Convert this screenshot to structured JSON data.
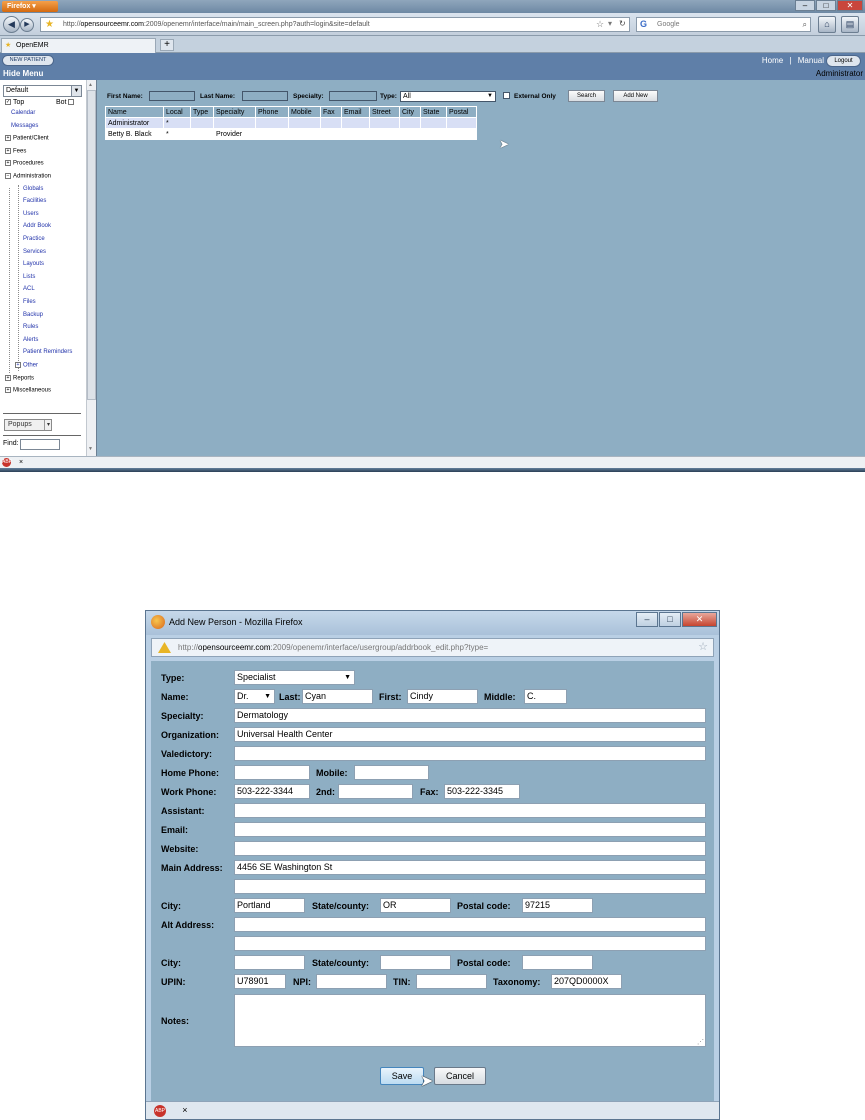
{
  "main_window": {
    "firefox_button": "Firefox",
    "url_prefix": "http://",
    "url_host": "opensourceemr.com",
    "url_rest": ":2009/openemr/interface/main/main_screen.php?auth=login&site=default",
    "search_placeholder": "Google",
    "tab_title": "OpenEMR",
    "new_patient": "NEW PATIENT",
    "hide_menu": "Hide Menu",
    "links": [
      "Home",
      "Manual"
    ],
    "logout": "Logout",
    "user": "Administrator"
  },
  "sidebar": {
    "view_select": "Default",
    "top_label": "Top",
    "bot_label": "Bot",
    "items": [
      {
        "label": "Calendar",
        "kind": "link"
      },
      {
        "label": "Messages",
        "kind": "link"
      },
      {
        "label": "Patient/Client",
        "kind": "group"
      },
      {
        "label": "Fees",
        "kind": "group"
      },
      {
        "label": "Procedures",
        "kind": "group"
      },
      {
        "label": "Administration",
        "kind": "group-open"
      },
      {
        "label": "Globals",
        "kind": "child"
      },
      {
        "label": "Facilities",
        "kind": "child"
      },
      {
        "label": "Users",
        "kind": "child"
      },
      {
        "label": "Addr Book",
        "kind": "child"
      },
      {
        "label": "Practice",
        "kind": "child"
      },
      {
        "label": "Services",
        "kind": "child"
      },
      {
        "label": "Layouts",
        "kind": "child"
      },
      {
        "label": "Lists",
        "kind": "child"
      },
      {
        "label": "ACL",
        "kind": "child"
      },
      {
        "label": "Files",
        "kind": "child"
      },
      {
        "label": "Backup",
        "kind": "child"
      },
      {
        "label": "Rules",
        "kind": "child"
      },
      {
        "label": "Alerts",
        "kind": "child"
      },
      {
        "label": "Patient Reminders",
        "kind": "child"
      },
      {
        "label": "Other",
        "kind": "child-group"
      },
      {
        "label": "Reports",
        "kind": "group"
      },
      {
        "label": "Miscellaneous",
        "kind": "group"
      }
    ],
    "popups": "Popups",
    "find_label": "Find:"
  },
  "addrbook": {
    "filters": {
      "first_name": "First Name:",
      "last_name": "Last Name:",
      "specialty": "Specialty:",
      "type": "Type:",
      "type_value": "All",
      "external_only": "External Only",
      "search": "Search",
      "add_new": "Add New"
    },
    "columns": [
      "Name",
      "Local",
      "Type",
      "Specialty",
      "Phone",
      "Mobile",
      "Fax",
      "Email",
      "Street",
      "City",
      "State",
      "Postal"
    ],
    "rows": [
      [
        "Administrator",
        "*",
        "",
        "",
        "",
        "",
        "",
        "",
        "",
        "",
        "",
        ""
      ],
      [
        "Betty B. Black",
        "*",
        "",
        "Provider",
        "",
        "",
        "",
        "",
        "",
        "",
        "",
        ""
      ]
    ]
  },
  "dialog": {
    "title": "Add New Person - Mozilla Firefox",
    "url_prefix": "http://",
    "url_host": "opensourceemr.com",
    "url_rest": ":2009/openemr/interface/usergroup/addrbook_edit.php?type=",
    "labels": {
      "type": "Type:",
      "name": "Name:",
      "last": "Last:",
      "first": "First:",
      "middle": "Middle:",
      "specialty": "Specialty:",
      "organization": "Organization:",
      "valedictory": "Valedictory:",
      "home_phone": "Home Phone:",
      "mobile": "Mobile:",
      "work_phone": "Work Phone:",
      "second": "2nd:",
      "fax": "Fax:",
      "assistant": "Assistant:",
      "email": "Email:",
      "website": "Website:",
      "main_address": "Main Address:",
      "city": "City:",
      "state": "State/county:",
      "postal": "Postal code:",
      "alt_address": "Alt Address:",
      "city2": "City:",
      "state2": "State/county:",
      "postal2": "Postal code:",
      "upin": "UPIN:",
      "npi": "NPI:",
      "tin": "TIN:",
      "taxonomy": "Taxonomy:",
      "notes": "Notes:"
    },
    "values": {
      "type": "Specialist",
      "title": "Dr.",
      "last": "Cyan",
      "first": "Cindy",
      "middle": "C.",
      "specialty": "Dermatology",
      "organization": "Universal Health Center",
      "valedictory": "",
      "home_phone": "",
      "mobile": "",
      "work_phone": "503-222-3344",
      "second": "",
      "fax": "503-222-3345",
      "assistant": "",
      "email": "",
      "website": "",
      "main_address": "4456 SE Washington St",
      "main_address2": "",
      "city": "Portland",
      "state": "OR",
      "postal": "97215",
      "alt_address": "",
      "alt_address2": "",
      "city2": "",
      "state2": "",
      "postal2": "",
      "upin": "U78901",
      "npi": "",
      "tin": "",
      "taxonomy": "207QD0000X",
      "notes": ""
    },
    "save": "Save",
    "cancel": "Cancel"
  },
  "statusbar": {
    "close": "×"
  },
  "colors": {
    "window_bg": "#8eaec3",
    "header": "#5f7fa8",
    "link": "#2233aa"
  }
}
